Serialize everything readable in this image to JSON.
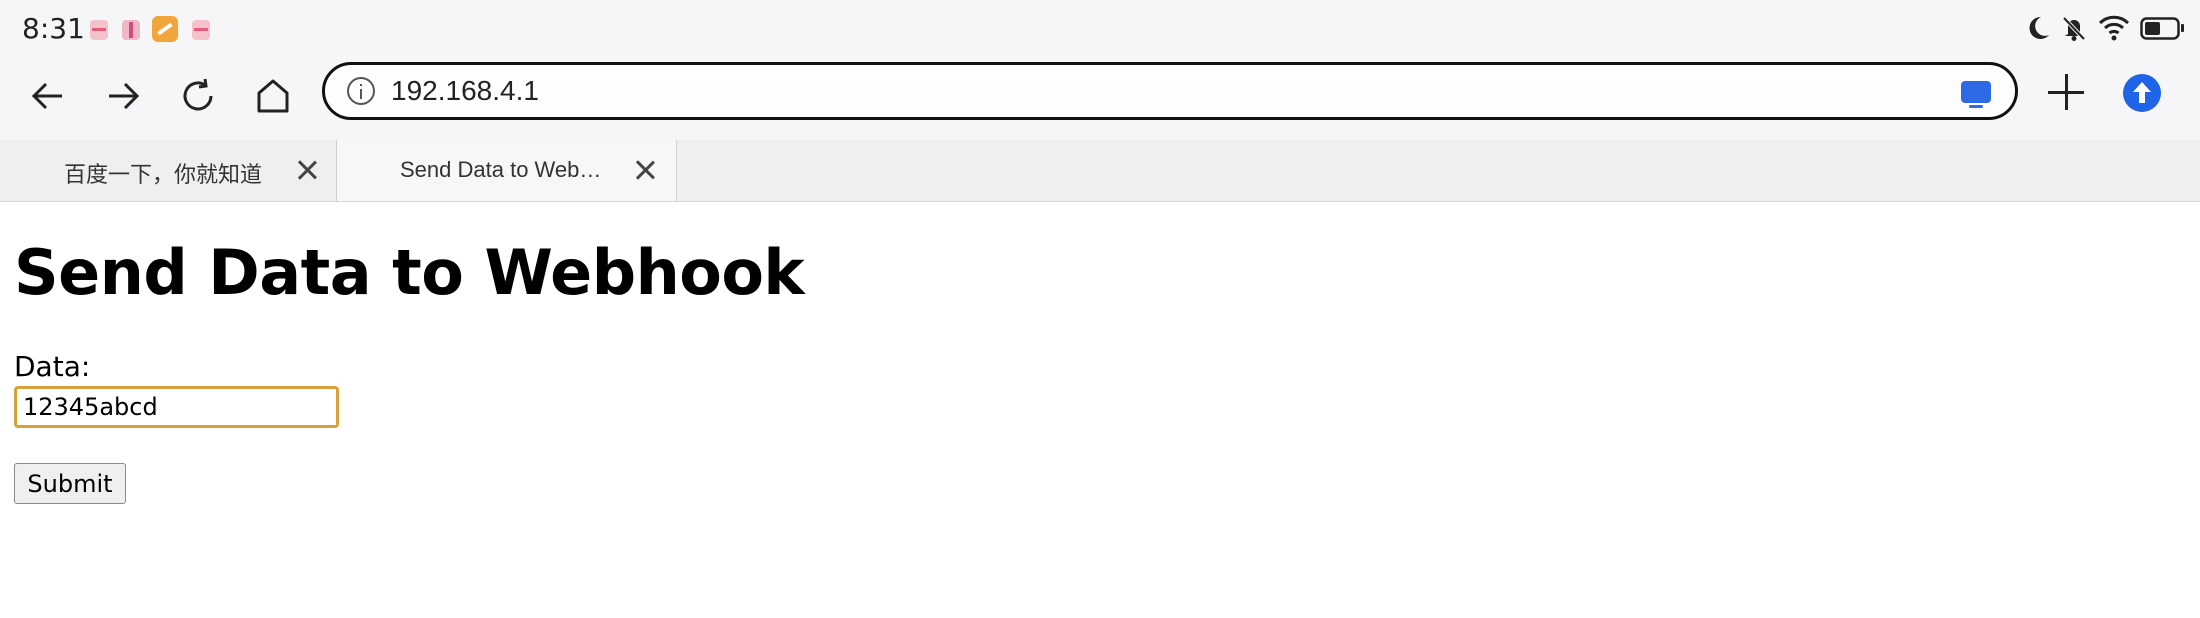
{
  "status_bar": {
    "time": "8:31",
    "notification_icons": [
      "app-notification-icon",
      "app-notification-icon",
      "app-notification-icon",
      "app-notification-icon"
    ],
    "system_icons": [
      "moon-icon",
      "bell-off-icon",
      "wifi-icon",
      "battery-icon"
    ]
  },
  "toolbar": {
    "back_icon": "arrow-left-icon",
    "forward_icon": "arrow-right-icon",
    "reload_icon": "reload-icon",
    "home_icon": "home-icon",
    "url": "192.168.4.1",
    "url_info_icon": "info-icon",
    "cast_icon": "cast-icon",
    "new_tab_icon": "plus-icon",
    "update_icon": "upload-icon",
    "accent_color": "#1f63e6"
  },
  "tabs": [
    {
      "label": "百度一下，你就知道",
      "active": false
    },
    {
      "label": "Send Data to Web…",
      "active": true
    }
  ],
  "page": {
    "title": "Send Data to Webhook",
    "data_label": "Data:",
    "data_value": "12345abcd",
    "submit_label": "Submit",
    "input_focus_color": "#d8a13a"
  }
}
